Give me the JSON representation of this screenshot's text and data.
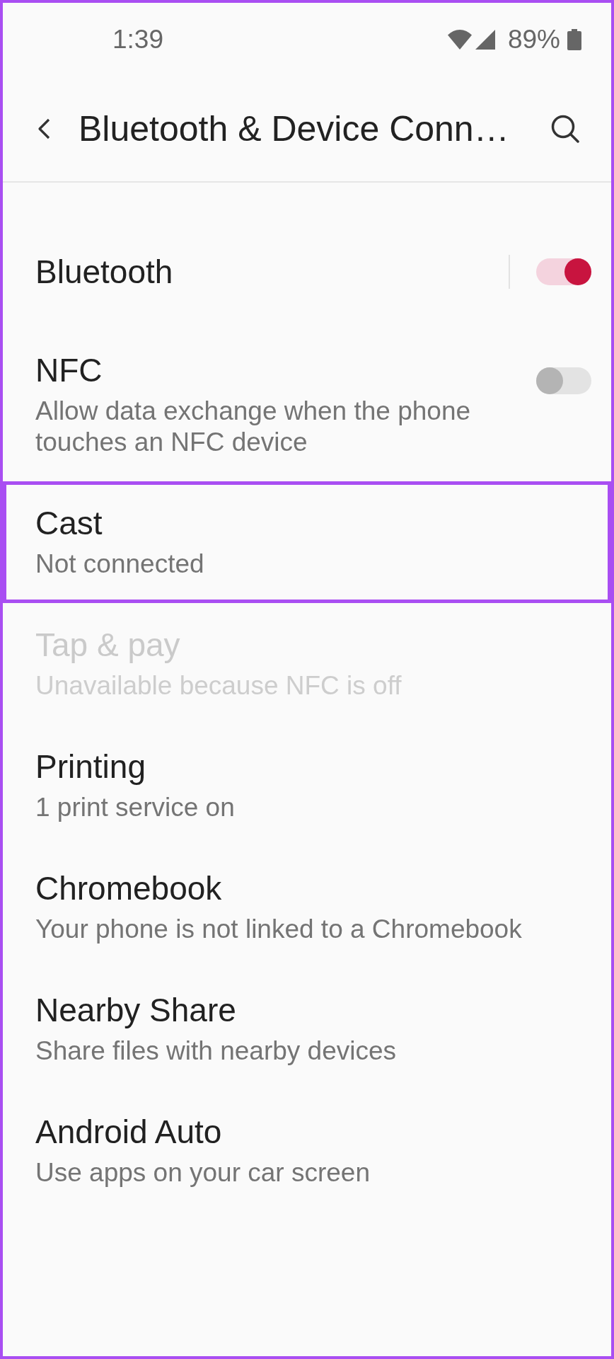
{
  "status_bar": {
    "time": "1:39",
    "battery": "89%"
  },
  "header": {
    "title": "Bluetooth & Device Conn…"
  },
  "settings": [
    {
      "kind": "split_toggle",
      "title": "Bluetooth",
      "on": true,
      "disabled": false,
      "highlighted": false
    },
    {
      "kind": "toggle",
      "title": "NFC",
      "subtitle": "Allow data exchange when the phone touches an NFC device",
      "on": false,
      "disabled": false,
      "highlighted": false
    },
    {
      "kind": "link",
      "title": "Cast",
      "subtitle": "Not connected",
      "disabled": false,
      "highlighted": true
    },
    {
      "kind": "link",
      "title": "Tap & pay",
      "subtitle": "Unavailable because NFC is off",
      "disabled": true,
      "highlighted": false
    },
    {
      "kind": "link",
      "title": "Printing",
      "subtitle": "1 print service on",
      "disabled": false,
      "highlighted": false
    },
    {
      "kind": "link",
      "title": "Chromebook",
      "subtitle": "Your phone is not linked to a Chromebook",
      "disabled": false,
      "highlighted": false
    },
    {
      "kind": "link",
      "title": "Nearby Share",
      "subtitle": "Share files with nearby devices",
      "disabled": false,
      "highlighted": false
    },
    {
      "kind": "link",
      "title": "Android Auto",
      "subtitle": "Use apps on your car screen",
      "disabled": false,
      "highlighted": false
    }
  ]
}
